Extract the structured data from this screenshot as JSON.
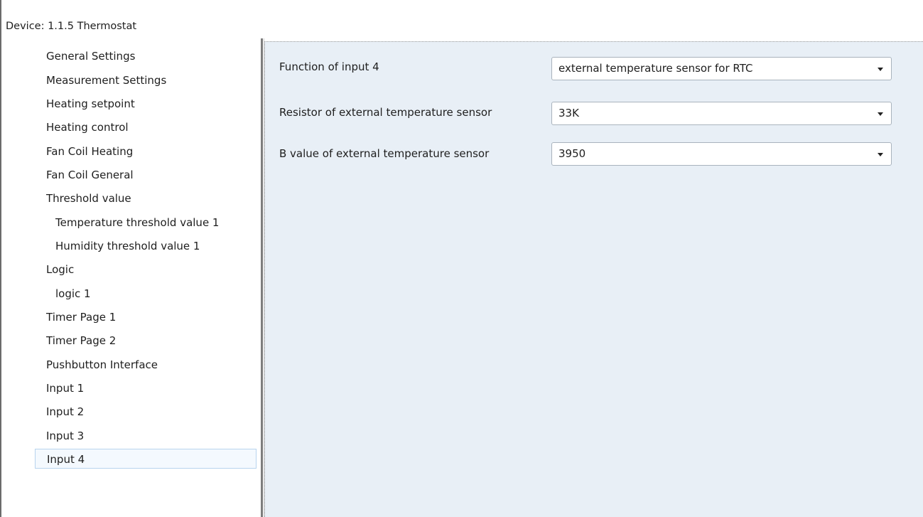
{
  "window": {
    "title": "Device: 1.1.5  Thermostat"
  },
  "nav": {
    "items": [
      {
        "label": "General Settings"
      },
      {
        "label": "Measurement Settings"
      },
      {
        "label": "Heating setpoint"
      },
      {
        "label": "Heating control"
      },
      {
        "label": "Fan Coil Heating"
      },
      {
        "label": "Fan Coil General"
      },
      {
        "label": "Threshold value"
      },
      {
        "label": "Temperature threshold value 1"
      },
      {
        "label": "Humidity threshold value 1"
      },
      {
        "label": "Logic"
      },
      {
        "label": "logic 1"
      },
      {
        "label": "Timer Page 1"
      },
      {
        "label": "Timer Page 2"
      },
      {
        "label": "Pushbutton Interface"
      },
      {
        "label": "Input 1"
      },
      {
        "label": "Input 2"
      },
      {
        "label": "Input 3"
      },
      {
        "label": "Input 4"
      }
    ],
    "selected": "Input 4"
  },
  "params": [
    {
      "label": "Function of input 4",
      "value": "external temperature sensor for RTC"
    },
    {
      "label": "Resistor of external temperature sensor",
      "value": "33K"
    },
    {
      "label": "B value of external temperature sensor",
      "value": "3950"
    }
  ],
  "colors": {
    "pane_background": "#e8eff6",
    "selection_border": "#b8d4ee",
    "selection_fill": "#f4f9fe"
  },
  "icons": {
    "dropdown": "chevron-down-icon"
  }
}
